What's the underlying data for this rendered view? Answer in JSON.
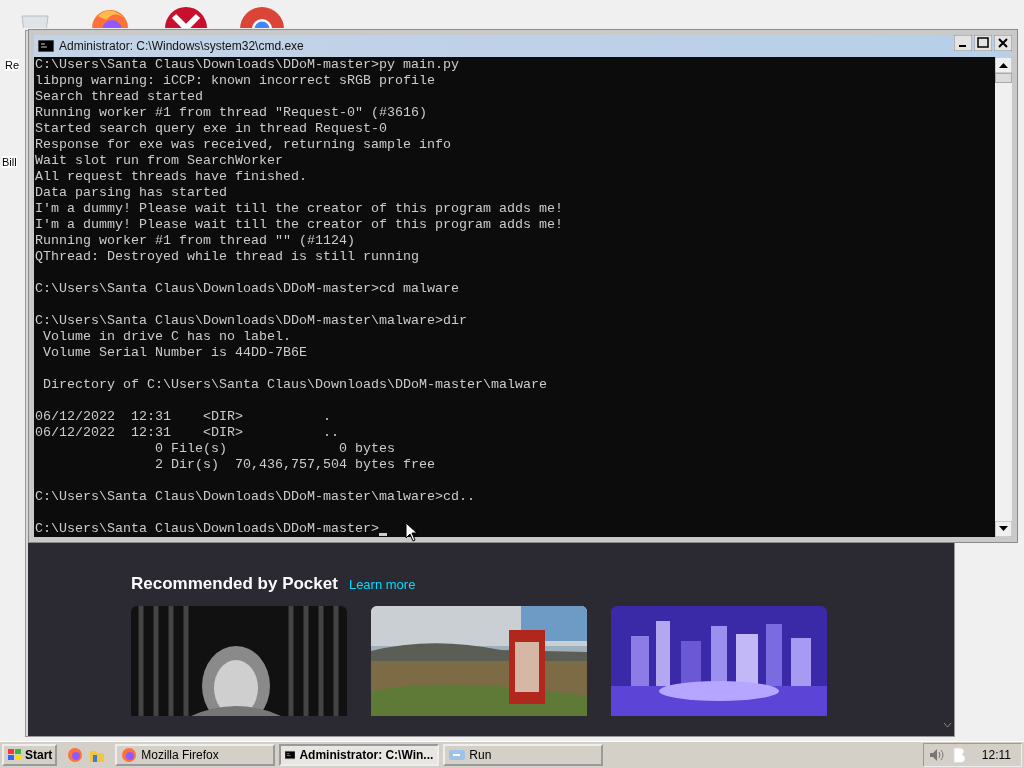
{
  "desktop": {
    "icon_labels": [
      "Re",
      "Bill"
    ]
  },
  "browser": {
    "section_title": "Recommended by Pocket",
    "link": "Learn more"
  },
  "console": {
    "title": "Administrator: C:\\Windows\\system32\\cmd.exe",
    "blocks": [
      [
        "C:\\Users\\Santa Claus\\Downloads\\DDoM-master>py main.py",
        "libpng warning: iCCP: known incorrect sRGB profile",
        "Search thread started",
        "Running worker #1 from thread \"Request-0\" (#3616)",
        "Started search query exe in thread Request-0",
        "Response for exe was received, returning sample info",
        "Wait slot run from SearchWorker",
        "All request threads have finished.",
        "Data parsing has started",
        "I'm a dummy! Please wait till the creator of this program adds me!",
        "I'm a dummy! Please wait till the creator of this program adds me!",
        "Running worker #1 from thread \"\" (#1124)",
        "QThread: Destroyed while thread is still running"
      ],
      [
        "C:\\Users\\Santa Claus\\Downloads\\DDoM-master>cd malware"
      ],
      [
        "C:\\Users\\Santa Claus\\Downloads\\DDoM-master\\malware>dir",
        " Volume in drive C has no label.",
        " Volume Serial Number is 44DD-7B6E"
      ],
      [
        " Directory of C:\\Users\\Santa Claus\\Downloads\\DDoM-master\\malware"
      ],
      [
        "06/12/2022  12:31    <DIR>          .",
        "06/12/2022  12:31    <DIR>          ..",
        "               0 File(s)              0 bytes",
        "               2 Dir(s)  70,436,757,504 bytes free"
      ],
      [
        "C:\\Users\\Santa Claus\\Downloads\\DDoM-master\\malware>cd.."
      ],
      [
        "C:\\Users\\Santa Claus\\Downloads\\DDoM-master>"
      ]
    ]
  },
  "taskbar": {
    "start": "Start",
    "tasks": [
      {
        "label": "Mozilla Firefox",
        "kind": "browser",
        "selected": false
      },
      {
        "label": "Administrator: C:\\Win...",
        "kind": "console",
        "selected": true
      },
      {
        "label": "Run",
        "kind": "run",
        "selected": false
      }
    ],
    "clock": "12:11"
  }
}
